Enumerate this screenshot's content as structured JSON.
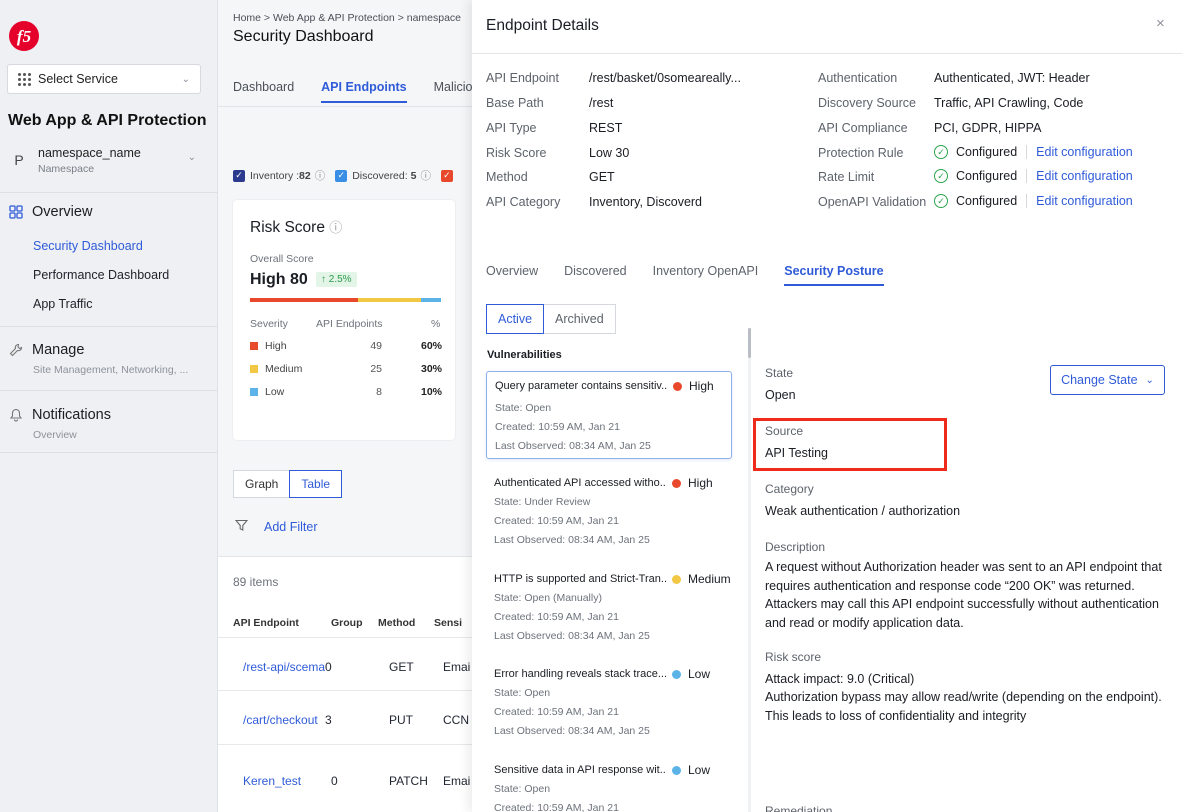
{
  "sidebar": {
    "service_select": "Select Service",
    "app_title": "Web App & API Protection",
    "namespace": {
      "avatar": "P",
      "name": "namespace_name",
      "sub": "Namespace"
    },
    "overview": {
      "label": "Overview",
      "items": [
        "Security Dashboard",
        "Performance Dashboard",
        "App Traffic"
      ],
      "active_index": 0
    },
    "manage": {
      "label": "Manage",
      "desc": "Site Management, Networking, ..."
    },
    "notifications": {
      "label": "Notifications",
      "desc": "Overview"
    }
  },
  "main": {
    "breadcrumb": "Home  >  Web App & API Protection  >  namespace",
    "title": "Security Dashboard",
    "tabs": [
      "Dashboard",
      "API Endpoints",
      "Maliciou"
    ],
    "chips": [
      {
        "label": "Inventory :",
        "value": "82",
        "color": "#2b3a8f"
      },
      {
        "label": "Discovered:",
        "value": "5",
        "color": "#3b8ee6"
      },
      {
        "label": "",
        "value": "",
        "color": "#e8482b"
      }
    ],
    "risk": {
      "title": "Risk Score",
      "overall_label": "Overall Score",
      "overall_value": "High 80",
      "change": "↑ 2.5%",
      "headers": [
        "Severity",
        "API Endpoints",
        "%"
      ],
      "rows": [
        {
          "sev": "High",
          "count": "49",
          "pct": "60%",
          "color": "#e8482b"
        },
        {
          "sev": "Medium",
          "count": "25",
          "pct": "30%",
          "color": "#f2c744"
        },
        {
          "sev": "Low",
          "count": "8",
          "pct": "10%",
          "color": "#5bb3e8"
        }
      ]
    },
    "view_toggle": [
      "Graph",
      "Table"
    ],
    "add_filter": "Add Filter",
    "items_count": "89 items",
    "table_headers": [
      "API Endpoint",
      "Group",
      "Method",
      "Sensi"
    ],
    "table_rows": [
      [
        "/rest-api/scema",
        "0",
        "GET",
        "Emai"
      ],
      [
        "/cart/checkout",
        "3",
        "PUT",
        "CCN"
      ],
      [
        "Keren_test",
        "0",
        "PATCH",
        "Emai"
      ]
    ]
  },
  "panel": {
    "title": "Endpoint Details",
    "close": "×",
    "left_fields": [
      {
        "label": "API Endpoint",
        "value": "/rest/basket/0someareally..."
      },
      {
        "label": "Base Path",
        "value": "/rest"
      },
      {
        "label": "API Type",
        "value": "REST"
      },
      {
        "label": "Risk Score",
        "value": "Low 30"
      },
      {
        "label": "Method",
        "value": "GET"
      },
      {
        "label": "API Category",
        "value": "Inventory, Discoverd"
      }
    ],
    "right_fields": [
      {
        "label": "Authentication",
        "value": "Authenticated, JWT: Header"
      },
      {
        "label": "Discovery Source",
        "value": "Traffic, API Crawling, Code"
      },
      {
        "label": "API Compliance",
        "value": "PCI, GDPR, HIPPA"
      },
      {
        "label": "Protection Rule",
        "value": "Configured",
        "link": "Edit configuration"
      },
      {
        "label": "Rate Limit",
        "value": "Configured",
        "link": "Edit configuration"
      },
      {
        "label": "OpenAPI Validation",
        "value": "Configured",
        "link": "Edit configuration"
      }
    ],
    "tabs": [
      "Overview",
      "Discovered",
      "Inventory OpenAPI",
      "Security Posture"
    ],
    "active_tab": 3,
    "toggle": [
      "Active",
      "Archived"
    ],
    "vulns_title": "Vulnerabilities",
    "vulns": [
      {
        "title": "Query parameter contains sensitiv...",
        "severity": "High",
        "color": "#e8482b",
        "state": "State: Open",
        "created": "Created: 10:59 AM, Jan 21",
        "observed": "Last Observed: 08:34 AM, Jan 25"
      },
      {
        "title": "Authenticated API accessed witho...",
        "severity": "High",
        "color": "#e8482b",
        "state": "State: Under Review",
        "created": "Created: 10:59 AM, Jan 21",
        "observed": "Last Observed: 08:34 AM, Jan 25"
      },
      {
        "title": "HTTP is supported and Strict-Tran...",
        "severity": "Medium",
        "color": "#f2c744",
        "state": "State: Open (Manually)",
        "created": "Created: 10:59 AM, Jan 21",
        "observed": "Last Observed: 08:34 AM, Jan 25"
      },
      {
        "title": "Error handling reveals stack trace...",
        "severity": "Low",
        "color": "#5bb3e8",
        "state": "State: Open",
        "created": "Created: 10:59 AM, Jan 21",
        "observed": "Last Observed: 08:34 AM, Jan 25"
      },
      {
        "title": "Sensitive data in API response wit...",
        "severity": "Low",
        "color": "#5bb3e8",
        "state": "State: Open",
        "created": "Created: 10:59 AM, Jan 21",
        "observed": ""
      }
    ],
    "detail": {
      "state_label": "State",
      "state_value": "Open",
      "change_state": "Change State",
      "source_label": "Source",
      "source_value": "API Testing",
      "category_label": "Category",
      "category_value": "Weak authentication / authorization",
      "description_label": "Description",
      "description_value": "A request without Authorization header was sent to an API endpoint that requires authentication and response code “200 OK” was returned. Attackers may call this API endpoint successfully without authentication and read or modify application data.",
      "risk_label": "Risk score",
      "risk_line1": "Attack impact: 9.0 (Critical)",
      "risk_line2": "Authorization bypass may allow read/write (depending on the endpoint). This leads to loss of confidentiality and integrity",
      "remediation_label": "Remediation"
    }
  }
}
